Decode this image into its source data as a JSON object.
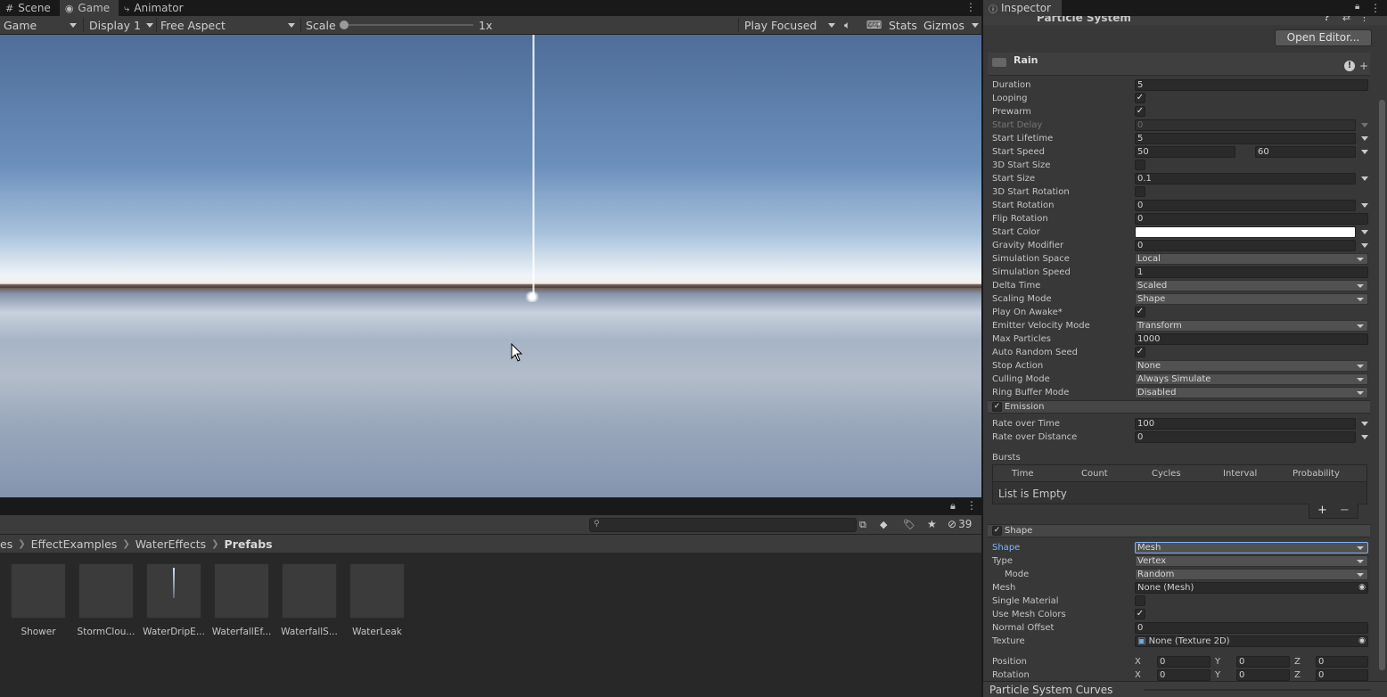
{
  "tabs": [
    {
      "label": "Scene",
      "icon": "scene-grid-icon"
    },
    {
      "label": "Game",
      "icon": "gamepad-icon"
    },
    {
      "label": "Animator",
      "icon": "animator-icon"
    }
  ],
  "game_toolbar": {
    "view_mode": "Game",
    "display": "Display 1",
    "aspect": "Free Aspect",
    "scale_label": "Scale",
    "scale_value": "1x",
    "play_mode": "Play Focused",
    "stats": "Stats",
    "gizmos": "Gizmos"
  },
  "project": {
    "hidden_count": "39",
    "breadcrumb": [
      "es",
      "EffectExamples",
      "WaterEffects",
      "Prefabs"
    ],
    "files": [
      "Shower",
      "StormClou...",
      "WaterDripE...",
      "WaterfallEf...",
      "WaterfallS...",
      "WaterLeak"
    ]
  },
  "inspector": {
    "tab": "Inspector",
    "component": "Particle System",
    "open_editor": "Open Editor...",
    "system_name": "Rain",
    "main": [
      {
        "label": "Duration",
        "value": "5",
        "kind": "field"
      },
      {
        "label": "Looping",
        "value": "✓",
        "kind": "check"
      },
      {
        "label": "Prewarm",
        "value": "✓",
        "kind": "check"
      },
      {
        "label": "Start Delay",
        "value": "0",
        "kind": "field-curve-disabled"
      },
      {
        "label": "Start Lifetime",
        "value": "5",
        "kind": "field-curve"
      },
      {
        "label": "Start Speed",
        "value": "50",
        "value2": "60",
        "kind": "range"
      },
      {
        "label": "3D Start Size",
        "value": "",
        "kind": "check"
      },
      {
        "label": "Start Size",
        "value": "0.1",
        "kind": "field-curve"
      },
      {
        "label": "3D Start Rotation",
        "value": "",
        "kind": "check"
      },
      {
        "label": "Start Rotation",
        "value": "0",
        "kind": "field-curve"
      },
      {
        "label": "Flip Rotation",
        "value": "0",
        "kind": "field"
      },
      {
        "label": "Start Color",
        "value": "",
        "kind": "color"
      },
      {
        "label": "Gravity Modifier",
        "value": "0",
        "kind": "field-curve"
      },
      {
        "label": "Simulation Space",
        "value": "Local",
        "kind": "dropdown"
      },
      {
        "label": "Simulation Speed",
        "value": "1",
        "kind": "field"
      },
      {
        "label": "Delta Time",
        "value": "Scaled",
        "kind": "dropdown"
      },
      {
        "label": "Scaling Mode",
        "value": "Shape",
        "kind": "dropdown"
      },
      {
        "label": "Play On Awake*",
        "value": "✓",
        "kind": "check"
      },
      {
        "label": "Emitter Velocity Mode",
        "value": "Transform",
        "kind": "dropdown"
      },
      {
        "label": "Max Particles",
        "value": "1000",
        "kind": "field"
      },
      {
        "label": "Auto Random Seed",
        "value": "✓",
        "kind": "check"
      },
      {
        "label": "Stop Action",
        "value": "None",
        "kind": "dropdown"
      },
      {
        "label": "Culling Mode",
        "value": "Always Simulate",
        "kind": "dropdown"
      },
      {
        "label": "Ring Buffer Mode",
        "value": "Disabled",
        "kind": "dropdown"
      }
    ],
    "emission": {
      "title": "Emission",
      "rate_over_time_label": "Rate over Time",
      "rate_over_time": "100",
      "rate_over_distance_label": "Rate over Distance",
      "rate_over_distance": "0",
      "bursts_label": "Bursts",
      "burst_columns": [
        "Time",
        "Count",
        "Cycles",
        "Interval",
        "Probability"
      ],
      "empty_text": "List is Empty"
    },
    "shape": {
      "title": "Shape",
      "rows": [
        {
          "label": "Shape",
          "value": "Mesh",
          "kind": "dropdown"
        },
        {
          "label": "Type",
          "value": "Vertex",
          "kind": "dropdown"
        },
        {
          "label": "Mode",
          "value": "Random",
          "kind": "dropdown"
        },
        {
          "label": "Mesh",
          "value": "None (Mesh)",
          "kind": "object"
        },
        {
          "label": "Single Material",
          "value": "",
          "kind": "check"
        },
        {
          "label": "Use Mesh Colors",
          "value": "✓",
          "kind": "check"
        },
        {
          "label": "Normal Offset",
          "value": "0",
          "kind": "field"
        },
        {
          "label": "Texture",
          "value": "None (Texture 2D)",
          "kind": "object"
        }
      ],
      "position_label": "Position",
      "position": [
        "0",
        "0",
        "0"
      ],
      "rotation_label": "Rotation",
      "rotation": [
        "0",
        "0",
        "0"
      ],
      "axes": [
        "X",
        "Y",
        "Z"
      ]
    },
    "curves_title": "Particle System Curves"
  },
  "colors": {
    "accent_label": "#7cb4ff",
    "start_color": "#ffffff"
  }
}
